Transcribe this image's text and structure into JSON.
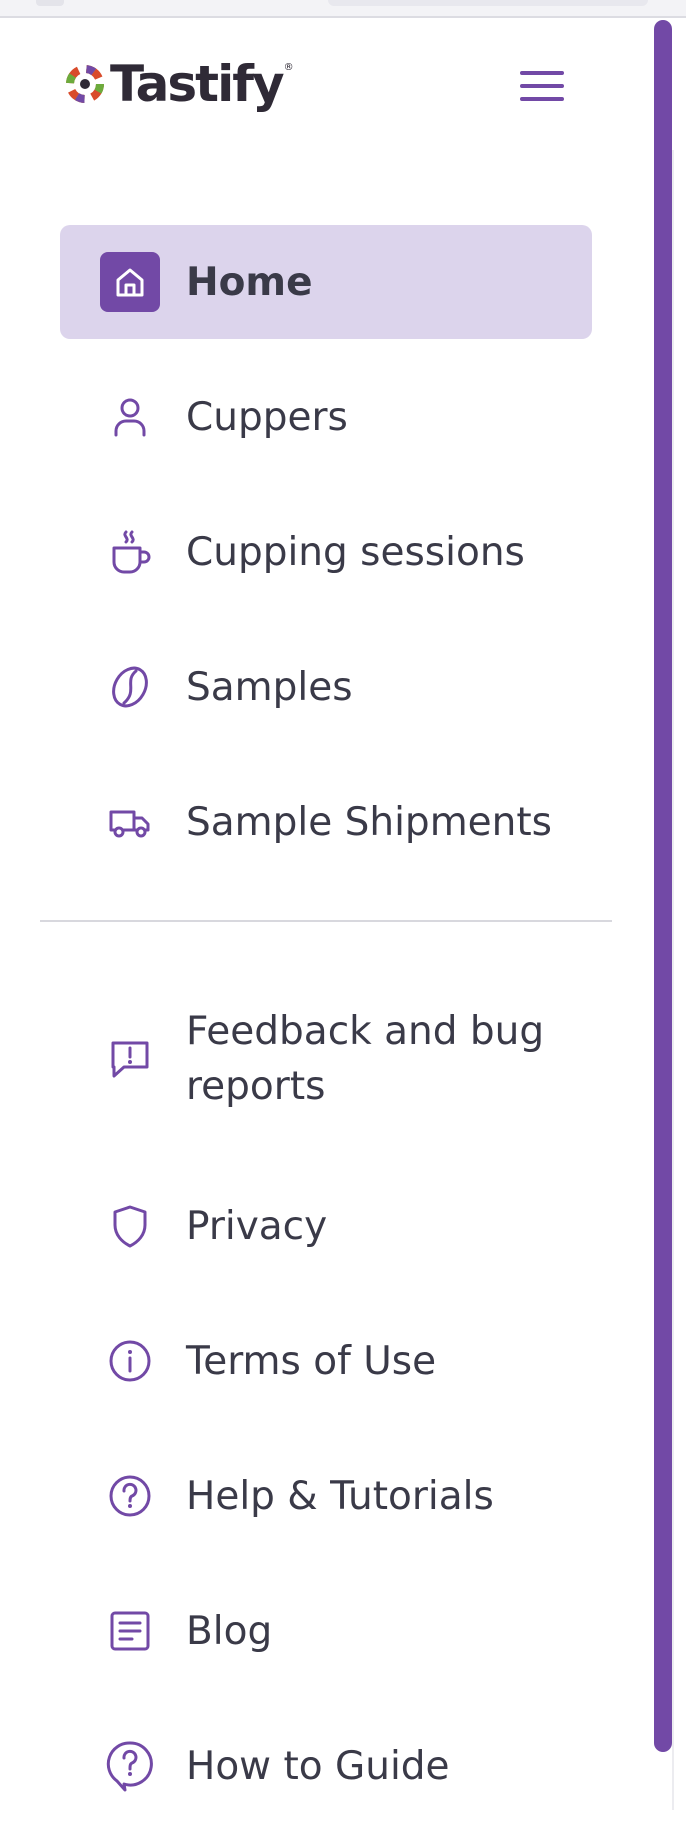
{
  "app": {
    "logo_text": "Tastify",
    "logo_reg": "®"
  },
  "colors": {
    "accent": "#7249a6",
    "active_bg": "#dcd4ec",
    "text": "#3a3a48"
  },
  "header": {
    "menu_icon": "hamburger-menu-icon"
  },
  "nav": {
    "primary": [
      {
        "label": "Home",
        "icon": "home-icon",
        "active": true
      },
      {
        "label": "Cuppers",
        "icon": "user-icon",
        "active": false
      },
      {
        "label": "Cupping sessions",
        "icon": "coffee-cup-icon",
        "active": false
      },
      {
        "label": "Samples",
        "icon": "coffee-bean-icon",
        "active": false
      },
      {
        "label": "Sample Shipments",
        "icon": "truck-icon",
        "active": false
      }
    ],
    "secondary": [
      {
        "label": "Feedback and bug reports",
        "icon": "feedback-icon"
      },
      {
        "label": "Privacy",
        "icon": "shield-icon"
      },
      {
        "label": "Terms of Use",
        "icon": "info-icon"
      },
      {
        "label": "Help & Tutorials",
        "icon": "help-icon"
      },
      {
        "label": "Blog",
        "icon": "blog-icon"
      },
      {
        "label": "How to Guide",
        "icon": "guide-icon"
      }
    ]
  }
}
